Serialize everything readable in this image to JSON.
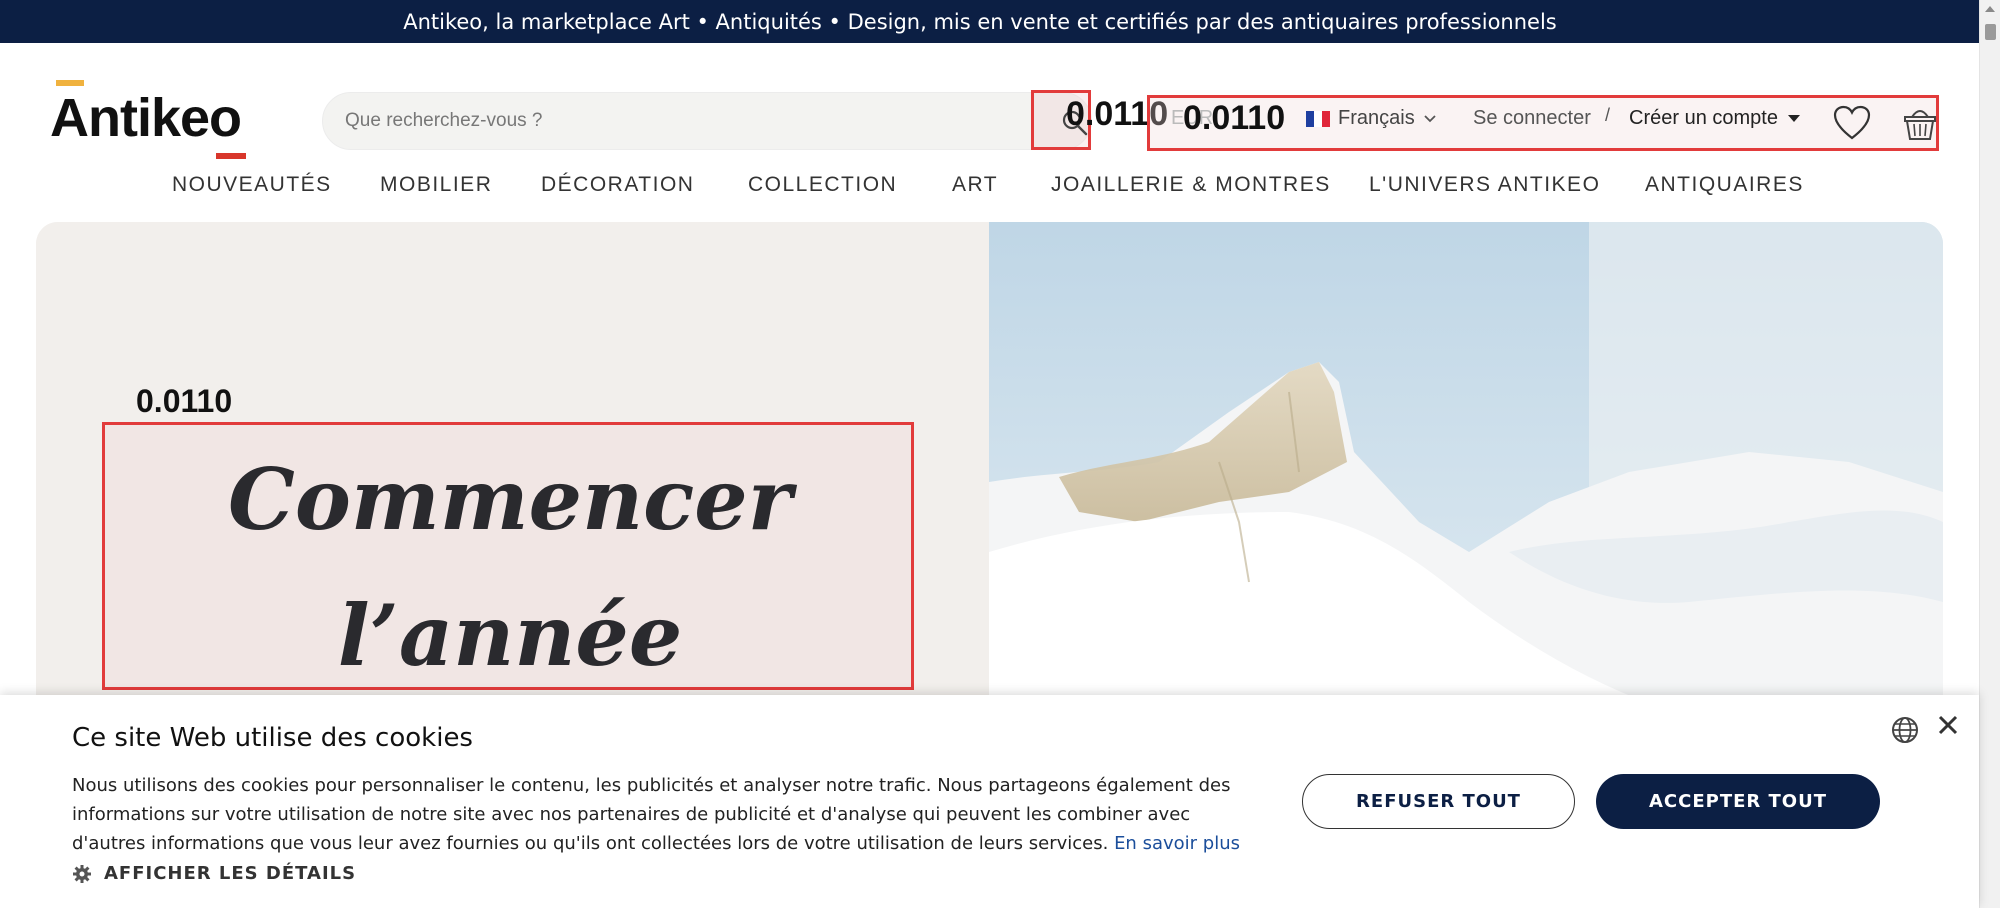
{
  "topbar": {
    "text": "Antikeo, la marketplace Art • Antiquités • Design, mis en vente et certifiés par des antiquaires professionnels"
  },
  "logo": {
    "text": "Antikeo"
  },
  "search": {
    "placeholder": "Que recherchez-vous ?"
  },
  "annotations": {
    "search_score": "0.0110",
    "header_score": "0.0110",
    "headline_score": "0.0110"
  },
  "header": {
    "currency": "EUR",
    "language": "Français",
    "login": "Se connecter",
    "separator": "/",
    "create_account": "Créer un compte"
  },
  "nav": {
    "items": [
      {
        "label": "NOUVEAUTÉS"
      },
      {
        "label": "MOBILIER"
      },
      {
        "label": "DÉCORATION"
      },
      {
        "label": "COLLECTION"
      },
      {
        "label": "ART"
      },
      {
        "label": "JOAILLERIE & MONTRES"
      },
      {
        "label": "L'UNIVERS ANTIKEO"
      },
      {
        "label": "ANTIQUAIRES"
      }
    ]
  },
  "hero": {
    "headline_line1": "Commencer",
    "headline_line2": "l’année autrement"
  },
  "cookie": {
    "title": "Ce site Web utilise des cookies",
    "text": "Nous utilisons des cookies pour personnaliser le contenu, les publicités et analyser notre trafic. Nous partageons également des informations sur votre utilisation de notre site avec nos partenaires de publicité et d'analyse qui peuvent les combiner avec d'autres informations que vous leur avez fournies ou qu'ils ont collectées lors de votre utilisation de leurs services.",
    "learn_more": "En savoir plus",
    "details": "AFFICHER LES DÉTAILS",
    "refuse": "REFUSER TOUT",
    "accept": "ACCEPTER TOUT"
  },
  "colors": {
    "navy": "#0c1f44",
    "annotation_red": "#e23b3b",
    "logo_yellow": "#f0b23e",
    "logo_red": "#d8362b",
    "link_blue": "#1b4e9b"
  }
}
